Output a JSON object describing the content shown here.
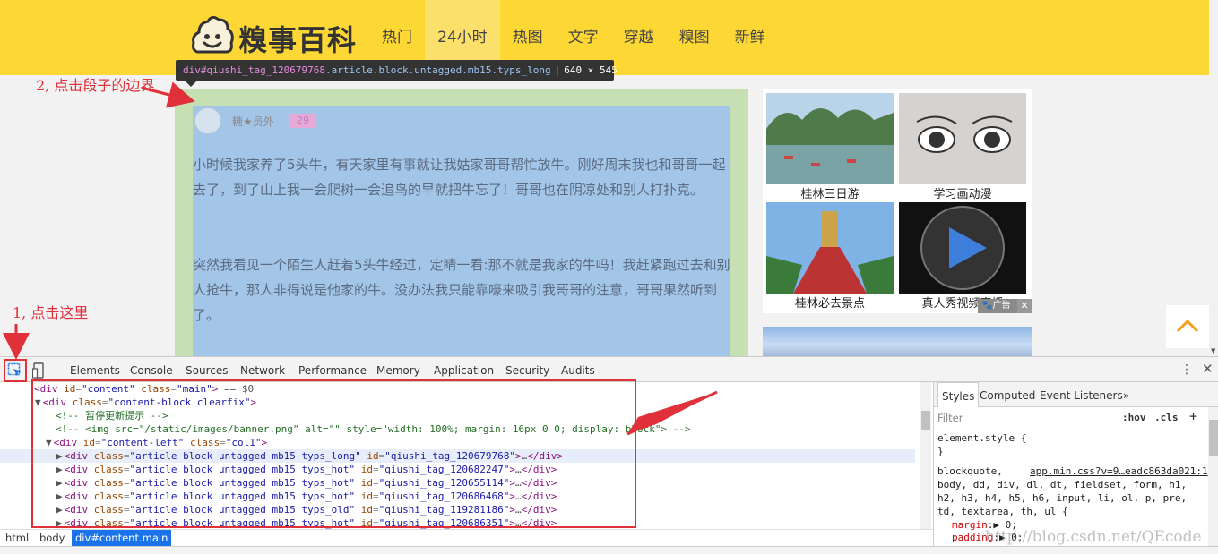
{
  "site": {
    "logo_text": "糗事百科",
    "nav": [
      "热门",
      "24小时",
      "热图",
      "文字",
      "穿越",
      "糗图",
      "新鲜"
    ],
    "active_nav": "24小时"
  },
  "tooltip": {
    "tag": "div",
    "id_part": "#qiushi_tag_120679768",
    "class_part": ".article.block.untagged.mb15.typs_long",
    "size": "640 × 545"
  },
  "article": {
    "author": "糖★员外",
    "age": "29",
    "para1": "小时候我家养了5头牛，有天家里有事就让我姑家哥哥帮忙放牛。刚好周末我也和哥哥一起去了，到了山上我一会爬树一会追鸟的早就把牛忘了！哥哥也在阴凉处和别人打扑克。",
    "para2": "突然我看见一个陌生人赶着5头牛经过，定睛一看:那不就是我家的牛吗！我赶紧跑过去和别人抢牛，那人非得说是他家的牛。没办法我只能靠嚎来吸引我哥哥的注意，哥哥果然听到了。"
  },
  "ads": {
    "items": [
      "桂林三日游",
      "学习画动漫",
      "桂林必去景点",
      "真人秀视频直播"
    ],
    "badge": "广告",
    "badge_close": "✕"
  },
  "annotations": {
    "step1": "1, 点击这里",
    "step2": "2, 点击段子的边界"
  },
  "devtools": {
    "tabs": [
      "Elements",
      "Console",
      "Sources",
      "Network",
      "Performance",
      "Memory",
      "Application",
      "Security",
      "Audits"
    ],
    "active_tab": "Elements",
    "more": "⋮",
    "close": "✕",
    "dom": [
      {
        "indent": 0,
        "kind": "open",
        "tag": "div",
        "attrs": [
          [
            "id",
            "content"
          ],
          [
            "class",
            "main"
          ]
        ],
        "suffix": " == $0",
        "selected": false
      },
      {
        "indent": 1,
        "kind": "open",
        "tag": "div",
        "attrs": [
          [
            "class",
            "content-block clearfix"
          ]
        ],
        "suffix": "",
        "selected": false
      },
      {
        "indent": 2,
        "kind": "comment",
        "text": "<!-- 暂停更新提示 -->"
      },
      {
        "indent": 2,
        "kind": "comment",
        "text": "<!-- <img src=\"/static/images/banner.png\" alt=\"\" style=\"width: 100%; margin: 16px 0 0; display: block\"> -->"
      },
      {
        "indent": 2,
        "kind": "open",
        "tag": "div",
        "attrs": [
          [
            "id",
            "content-left"
          ],
          [
            "class",
            "col1"
          ]
        ],
        "suffix": "",
        "selected": false
      },
      {
        "indent": 3,
        "kind": "collapsed",
        "tag": "div",
        "attrs": [
          [
            "class",
            "article block untagged mb15 typs_long"
          ],
          [
            "id",
            "qiushi_tag_120679768"
          ]
        ],
        "selected": true
      },
      {
        "indent": 3,
        "kind": "collapsed",
        "tag": "div",
        "attrs": [
          [
            "class",
            "article block untagged mb15 typs_hot"
          ],
          [
            "id",
            "qiushi_tag_120682247"
          ]
        ],
        "selected": false
      },
      {
        "indent": 3,
        "kind": "collapsed",
        "tag": "div",
        "attrs": [
          [
            "class",
            "article block untagged mb15 typs_hot"
          ],
          [
            "id",
            "qiushi_tag_120655114"
          ]
        ],
        "selected": false
      },
      {
        "indent": 3,
        "kind": "collapsed",
        "tag": "div",
        "attrs": [
          [
            "class",
            "article block untagged mb15 typs_hot"
          ],
          [
            "id",
            "qiushi_tag_120686468"
          ]
        ],
        "selected": false
      },
      {
        "indent": 3,
        "kind": "collapsed",
        "tag": "div",
        "attrs": [
          [
            "class",
            "article block untagged mb15 typs_old"
          ],
          [
            "id",
            "qiushi_tag_119281186"
          ]
        ],
        "selected": false
      },
      {
        "indent": 3,
        "kind": "collapsed",
        "tag": "div",
        "attrs": [
          [
            "class",
            "article block untagged mb15 typs_hot"
          ],
          [
            "id",
            "qiushi_tag_120686351"
          ]
        ],
        "selected": false
      }
    ],
    "breadcrumb": [
      "html",
      "body",
      "div#content.main"
    ],
    "styles": {
      "tabs": [
        "Styles",
        "Computed",
        "Event Listeners"
      ],
      "more_tabs": "»",
      "filter_placeholder": "Filter",
      "hov": ":hov",
      "cls": ".cls",
      "plus": "+",
      "element_style_open": "element.style {",
      "element_style_close": "}",
      "selector": "blockquote,",
      "source": "app.min.css?v=9…eadc863da021:1",
      "selector_lines": [
        "body, dd, div, dl, dt, fieldset, form, h1,",
        "h2, h3, h4, h5, h6, input, li, ol, p, pre,",
        "td, textarea, th, ul {"
      ],
      "props": [
        [
          "margin",
          "0"
        ],
        [
          "padding",
          "0"
        ]
      ]
    }
  },
  "watermark": "http://blog.csdn.net/QEcode"
}
